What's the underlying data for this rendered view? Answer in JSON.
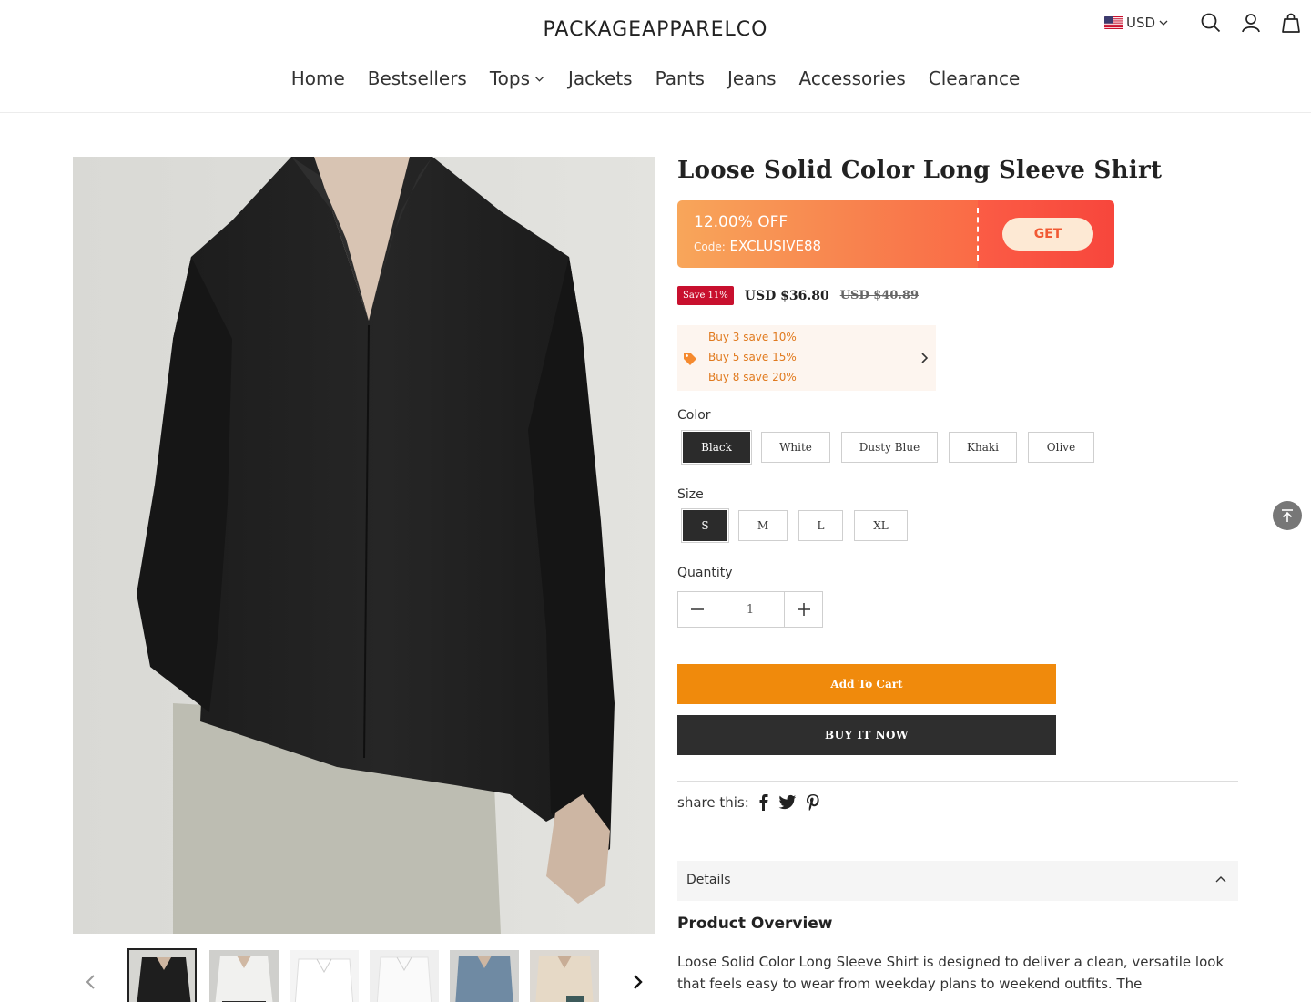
{
  "header": {
    "logo": "PACKAGEAPPARELCO",
    "currency": "USD",
    "nav": [
      {
        "label": "Home"
      },
      {
        "label": "Bestsellers"
      },
      {
        "label": "Tops"
      },
      {
        "label": "Jackets"
      },
      {
        "label": "Pants"
      },
      {
        "label": "Jeans"
      },
      {
        "label": "Accessories"
      },
      {
        "label": "Clearance"
      }
    ]
  },
  "product": {
    "title": "Loose Solid Color Long Sleeve Shirt",
    "coupon": {
      "off": "12.00% OFF",
      "code_label": "Code:",
      "code": "EXCLUSIVE88",
      "get": "GET"
    },
    "save_badge": "Save 11%",
    "price": "USD $36.80",
    "old_price": "USD $40.89",
    "discounts": [
      "Buy 3 save 10%",
      "Buy 5 save 15%",
      "Buy 8 save 20%"
    ],
    "color_label": "Color",
    "colors": [
      "Black",
      "White",
      "Dusty Blue",
      "Khaki",
      "Olive"
    ],
    "selected_color": "Black",
    "size_label": "Size",
    "sizes": [
      "S",
      "M",
      "L",
      "XL"
    ],
    "selected_size": "S",
    "quantity_label": "Quantity",
    "quantity": "1",
    "add_to_cart": "Add To Cart",
    "buy_now": "BUY IT NOW",
    "share_label": "share this:",
    "details_label": "Details",
    "overview_title": "Product Overview",
    "overview_text": "Loose Solid Color Long Sleeve Shirt is designed to deliver a clean, versatile look that feels easy to wear from weekday plans to weekend outfits. The"
  },
  "colors": {
    "accent_orange": "#f08a0c",
    "dark_button": "#2e2e2e",
    "save_red": "#c8102e",
    "discount_text": "#e07a1f"
  },
  "icons": [
    "us-flag-icon",
    "chevron-down-icon",
    "search-icon",
    "user-icon",
    "bag-icon",
    "tag-icon",
    "chevron-right-icon",
    "minus-icon",
    "plus-icon",
    "facebook-icon",
    "twitter-icon",
    "pinterest-icon",
    "chevron-up-icon",
    "arrow-up-icon",
    "chevron-left-icon"
  ]
}
